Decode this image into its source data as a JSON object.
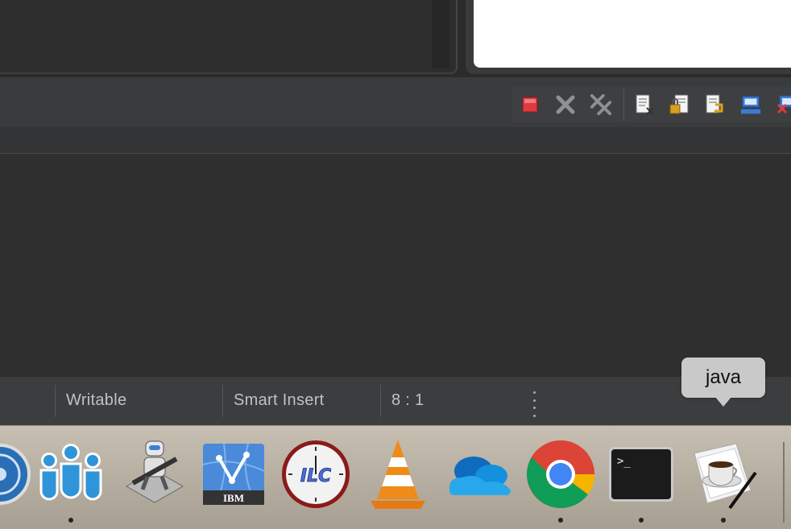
{
  "status_bar": {
    "writable": "Writable",
    "insert_mode": "Smart Insert",
    "cursor_position": "8 : 1"
  },
  "tooltip": {
    "text": "java"
  },
  "console_toolbar": {
    "buttons": [
      "terminate-icon",
      "remove-launch-icon",
      "remove-all-terminated-icon",
      "clear-console-icon",
      "scroll-lock-icon",
      "word-wrap-icon",
      "display-selected-console-icon",
      "close-console-icon"
    ],
    "colors": {
      "terminate": "#e0393e"
    }
  },
  "dock": {
    "icons": [
      "system-preferences-icon",
      "teams-icon",
      "automator-icon",
      "ibm-app-icon",
      "ilc-clock-icon",
      "vlc-icon",
      "onedrive-icon",
      "chrome-icon",
      "terminal-icon",
      "java-coffee-icon"
    ],
    "ibm_label": "IBM",
    "ilc_label": "ILC",
    "terminal_prompt": ">_"
  }
}
